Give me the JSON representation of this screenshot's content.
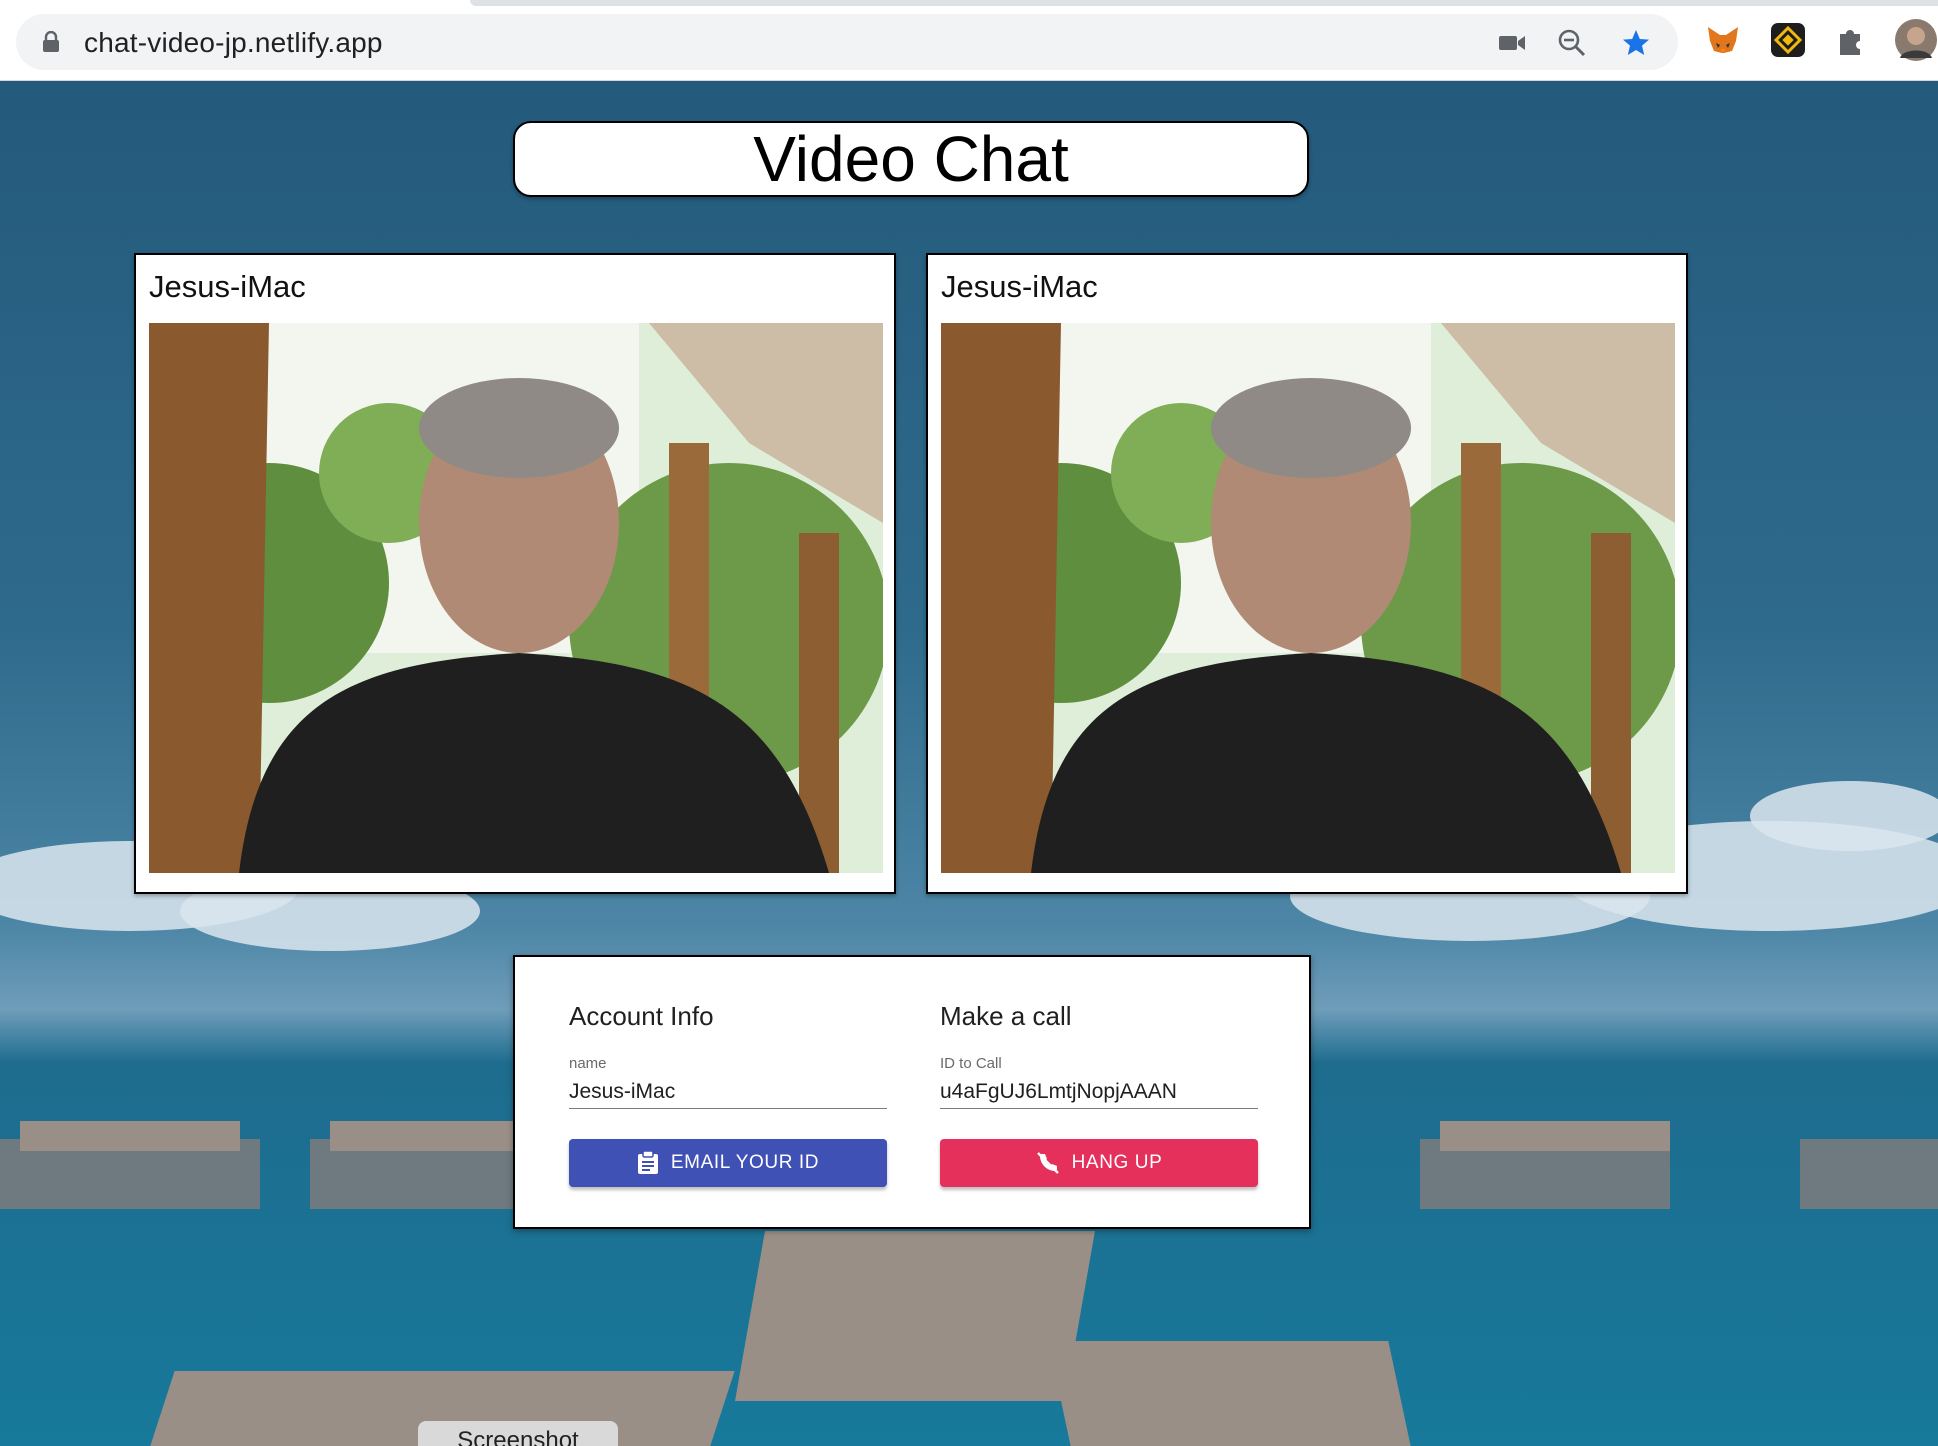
{
  "browser": {
    "url": "chat-video-jp.netlify.app",
    "icons": [
      "lock-icon",
      "camera-icon",
      "zoom-out-icon",
      "bookmark-star-icon",
      "metamask-fox-icon",
      "binance-wallet-icon",
      "extensions-puzzle-icon",
      "profile-avatar"
    ]
  },
  "page": {
    "title": "Video Chat"
  },
  "videos": [
    {
      "name": "Jesus-iMac"
    },
    {
      "name": "Jesus-iMac"
    }
  ],
  "account": {
    "heading": "Account Info",
    "name_label": "name",
    "name_value": "Jesus-iMac",
    "email_button": "EMAIL YOUR ID"
  },
  "call": {
    "heading": "Make a call",
    "id_label": "ID to Call",
    "id_value": "u4aFgUJ6LmtjNopjAAAN",
    "hangup_button": "HANG UP"
  },
  "footer": {
    "screenshot_button": "Screenshot"
  },
  "colors": {
    "email_button": "#3f51b5",
    "hangup_button": "#e5305c",
    "star_active": "#1a73e8"
  }
}
